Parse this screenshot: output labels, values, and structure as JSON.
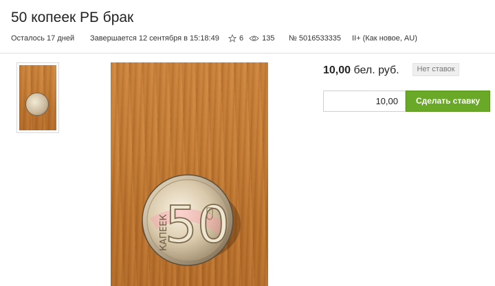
{
  "title": "50 копеек РБ брак",
  "meta": {
    "time_left": "Осталось 17 дней",
    "ends": "Завершается 12 сентября в 15:18:49",
    "stars": "6",
    "views": "135",
    "lot_number": "№ 5016533335",
    "condition": "II+ (Как новое, AU)"
  },
  "price": {
    "amount": "10,00",
    "currency": "бел. руб.",
    "bids_badge": "Нет ставок"
  },
  "bid": {
    "input_value": "10,00",
    "button_label": "Сделать ставку"
  },
  "coin": {
    "denomination": "50",
    "word": "КАПЕЕК"
  },
  "colors": {
    "accent_green": "#6aa827",
    "badge_bg": "#efefef"
  },
  "icons": [
    "star-icon",
    "eye-icon"
  ]
}
